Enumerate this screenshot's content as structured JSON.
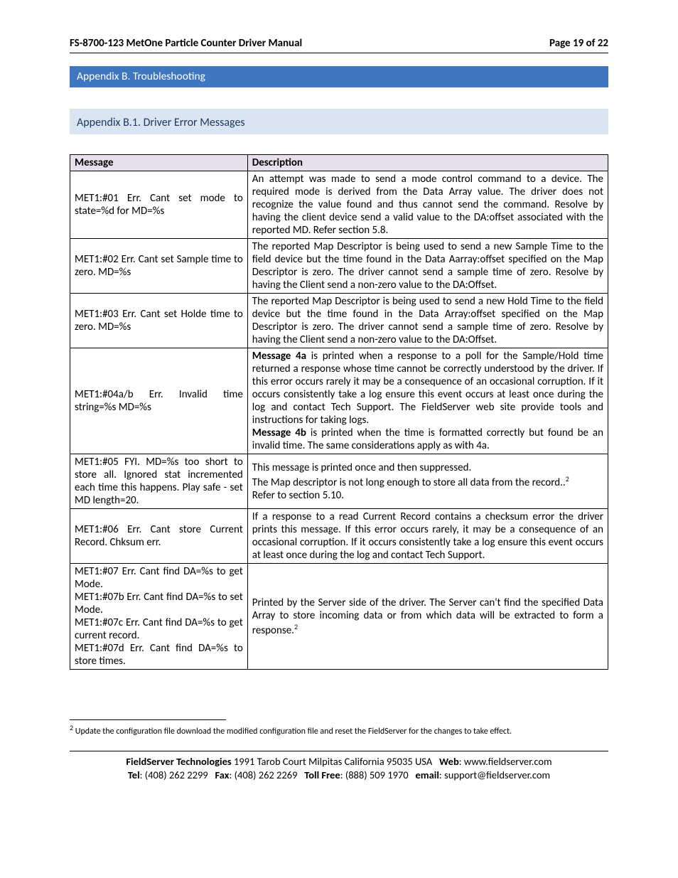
{
  "header": {
    "title": "FS-8700-123 MetOne Particle Counter Driver Manual",
    "page": "Page 19 of 22"
  },
  "section": {
    "title": "Appendix B. Troubleshooting"
  },
  "subsection": {
    "title": "Appendix B.1. Driver Error Messages"
  },
  "table": {
    "headers": {
      "message": "Message",
      "description": "Description"
    },
    "rows": [
      {
        "message": "MET1:#01 Err. Cant set mode to state=%d for MD=%s",
        "description": "An attempt was made to send a mode control command to a device. The required mode is derived from the Data Array value. The driver does not recognize the value found and thus cannot send the command.  Resolve by having the client device send a valid value to the DA:offset associated with the reported MD.  Refer section 5.8."
      },
      {
        "message": "MET1:#02 Err. Cant set Sample time to zero. MD=%s",
        "description": "The reported Map Descriptor is being used to send a new Sample Time to the field device but the time found in the Data Aarray:offset specified on the Map Descriptor is zero. The driver cannot send a sample time of zero. Resolve by having the Client send a non-zero value to the DA:Offset."
      },
      {
        "message": "MET1:#03 Err. Cant set Holde time to zero. MD=%s",
        "description": "The reported Map Descriptor is being used to send a new Hold Time to the field device but the time found in the Data Array:offset specified on the Map Descriptor is zero. The driver cannot send a sample time of zero. Resolve by having the Client send a non-zero value to the DA:Offset."
      },
      {
        "message": "MET1:#04a/b Err. Invalid time string=%s MD=%s",
        "description_html": "<b>Message 4a</b> is printed when a response to a poll for the Sample/Hold time returned a response whose time cannot be correctly understood by the driver.  If this error occurs rarely it may be a consequence of an occasional corruption.  If it occurs consistently take a log ensure this event occurs at least once during the log and contact Tech Support. The FieldServer web site provide tools and instructions for taking logs.<br><b>Message 4b</b> is printed when the time is formatted correctly but found be an invalid time. The same considerations apply as with 4a."
      },
      {
        "message": "MET1:#05 FYI. MD=%s too short to store all. Ignored stat incremented each time this happens. Play safe - set MD length=20.",
        "description_html": "This message is printed once and then suppressed.<br>The Map descriptor is not long enough to store all data from the record..<span class='sup2'>2</span><br>Refer to section 5.10."
      },
      {
        "message": "MET1:#06 Err. Cant store Current Record. Chksum err.",
        "description": "If a response to a read Current Record contains a checksum error the driver prints this message.  If this error occurs rarely, it may be a consequence of an occasional corruption. If it occurs consistently take a log ensure this event occurs at least once during the log and contact Tech Support."
      },
      {
        "message_lines": [
          "MET1:#07 Err. Cant find DA=%s to get Mode.",
          "MET1:#07b Err. Cant find DA=%s to set Mode.",
          "MET1:#07c Err. Cant find DA=%s to get current record.",
          "MET1:#07d Err. Cant find DA=%s to store times."
        ],
        "description_html": "Printed by the Server side of the driver. The Server can't find the specified Data Array to store incoming data or from which data will be extracted to form a response.<span class='sup2'>2</span>"
      }
    ]
  },
  "footnote": {
    "num": "2",
    "text": " Update the configuration file download the modified configuration file and reset the FieldServer for the changes to take effect."
  },
  "footer": {
    "line1_html": "<b>FieldServer Technologies</b> 1991 Tarob Court Milpitas California 95035 USA&nbsp;&nbsp;&nbsp;<b>Web</b>: www.fieldserver.com",
    "line2_html": "<b>Tel</b>: (408) 262 2299&nbsp;&nbsp;&nbsp;<b>Fax</b>: (408) 262 2269&nbsp;&nbsp;&nbsp;<b>Toll Free</b>: (888) 509 1970&nbsp;&nbsp;&nbsp;<b>email</b>: support@fieldserver.com"
  }
}
